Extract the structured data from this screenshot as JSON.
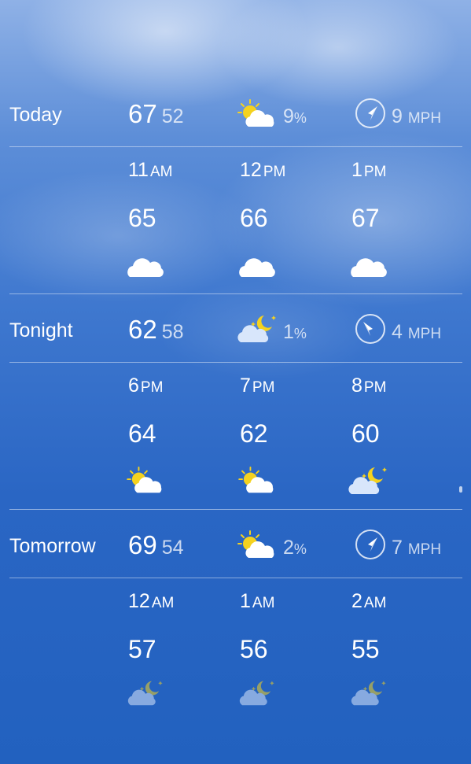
{
  "days": [
    {
      "label": "Today",
      "high": "67",
      "low": "52",
      "condition_icon": "partly-sunny-icon",
      "precip": "9",
      "precip_unit": "%",
      "wind_icon": "compass-icon",
      "wind_speed": "9",
      "wind_unit": "MPH",
      "hours": [
        {
          "time": "11",
          "ampm": "AM",
          "temp": "65",
          "icon": "cloud-icon"
        },
        {
          "time": "12",
          "ampm": "PM",
          "temp": "66",
          "icon": "cloud-icon"
        },
        {
          "time": "1",
          "ampm": "PM",
          "temp": "67",
          "icon": "cloud-icon"
        }
      ]
    },
    {
      "label": "Tonight",
      "high": "62",
      "low": "58",
      "condition_icon": "night-cloudy-icon",
      "precip": "1",
      "precip_unit": "%",
      "wind_icon": "compass-icon",
      "wind_speed": "4",
      "wind_unit": "MPH",
      "hours": [
        {
          "time": "6",
          "ampm": "PM",
          "temp": "64",
          "icon": "partly-sunny-icon"
        },
        {
          "time": "7",
          "ampm": "PM",
          "temp": "62",
          "icon": "partly-sunny-icon"
        },
        {
          "time": "8",
          "ampm": "PM",
          "temp": "60",
          "icon": "night-cloudy-icon"
        }
      ]
    },
    {
      "label": "Tomorrow",
      "high": "69",
      "low": "54",
      "condition_icon": "partly-sunny-icon",
      "precip": "2",
      "precip_unit": "%",
      "wind_icon": "compass-icon",
      "wind_speed": "7",
      "wind_unit": "MPH",
      "hours": [
        {
          "time": "12",
          "ampm": "AM",
          "temp": "57",
          "icon": "night-cloudy-icon"
        },
        {
          "time": "1",
          "ampm": "AM",
          "temp": "56",
          "icon": "night-cloudy-icon"
        },
        {
          "time": "2",
          "ampm": "AM",
          "temp": "55",
          "icon": "night-cloudy-icon"
        }
      ]
    }
  ],
  "colors": {
    "sun": "#f5d21f",
    "moon": "#f5d21f",
    "cloud": "#ffffff",
    "cloud_night": "#d8e6fb"
  }
}
